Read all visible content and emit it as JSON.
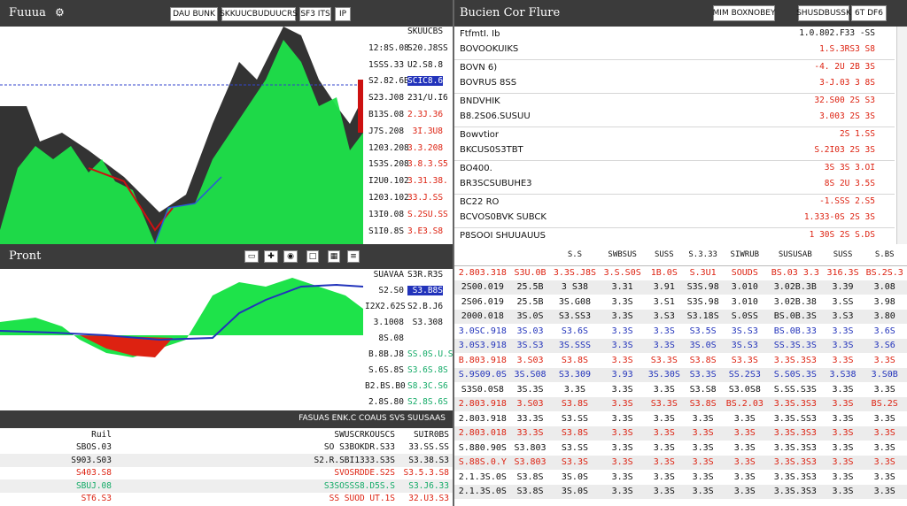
{
  "left_panel": {
    "title": "Fuuua",
    "tabs": [
      "DAU BUNK",
      "SKKUUCBUDUUCRS",
      "SF3 ITS",
      "IP"
    ],
    "price_labels": [
      {
        "left": "",
        "right": "SKUUCBS"
      },
      {
        "left": "12:8S.08",
        "right": "S20.J8SS"
      },
      {
        "left": "1SSS.33",
        "right": "U2.S8.8",
        "style": "white"
      },
      {
        "left": "S2.82.6B",
        "right": "SCIC8.6S",
        "style": "blue"
      },
      {
        "left": "S23.J08",
        "right": "231/U.I6"
      },
      {
        "left": "B13S.08",
        "right": "2.3J.36",
        "style": "red"
      },
      {
        "left": "J7S.208",
        "right": "3I.3U8",
        "style": "red"
      },
      {
        "left": "1203.208",
        "right": "3.3.208",
        "style": "red"
      },
      {
        "left": "1S3S.208",
        "right": "3.8.3.S5",
        "style": "red"
      },
      {
        "left": "I2U0.102",
        "right": "3.31.38.",
        "style": "red"
      },
      {
        "left": "1203.102",
        "right": "33.J.SS",
        "style": "red"
      },
      {
        "left": "13I0.08",
        "right": "S.2SU.SS",
        "style": "red"
      },
      {
        "left": "S1I0.8S",
        "right": "3.E3.S8",
        "style": "red"
      }
    ]
  },
  "mid_panel": {
    "title": "Pront",
    "price_labels": [
      {
        "left": "SUAVAA",
        "right": "S3R.R3S"
      },
      {
        "left": "S2.S0",
        "right": "S3.B8S",
        "style": "blue"
      },
      {
        "left": "I2X2.62S",
        "right": "S2.B.J6"
      },
      {
        "left": "3.1008",
        "right": "S3.308"
      },
      {
        "left": "8S.08",
        "right": "",
        "style": "red"
      },
      {
        "left": "B.8B.J8",
        "right": "SS.0S.U.S",
        "style": "green"
      },
      {
        "left": "S.6S.8S",
        "right": "S3.6S.8S",
        "style": "green"
      },
      {
        "left": "B2.BS.B0",
        "right": "S8.3C.S6",
        "style": "green"
      },
      {
        "left": "2.8S.80",
        "right": "S2.8S.6S",
        "style": "green"
      }
    ]
  },
  "bottom_panel": {
    "title": "FASUAS ENK.C COAUS SVS SUUSAAS",
    "header": [
      "Ruil",
      "SWUSCRKOUSCS",
      "SUIR0BS"
    ],
    "rows": [
      {
        "a": "SBOS.03",
        "b": "SO S3BOKDR.S33",
        "c": "33.SS.SS",
        "color": "black"
      },
      {
        "a": "S903.S03",
        "b": "S2.R.SBI1333.S3S",
        "c": "S3.38.S3",
        "color": "black"
      },
      {
        "a": "S403.S8",
        "b": "SVOSRDDE.S2S",
        "c": "S3.5.3.S8",
        "color": "red"
      },
      {
        "a": "SBUJ.08",
        "b": "S3SOSSS8.D5S.S",
        "c": "S3.J6.33",
        "color": "green"
      },
      {
        "a": "ST6.S3",
        "b": "SS SUOD UT.1S",
        "c": "32.U3.S3",
        "color": "red"
      }
    ]
  },
  "right_panel": {
    "title": "Bucien Cor Flure",
    "tabs": [
      "MIM BOXNOBEY",
      "SHUSDBUSSK",
      "6T DF6"
    ],
    "order_book": [
      {
        "l1": "FtfmtI. Ib",
        "l2": "BOVOOKUIKS",
        "r1": "1.0.802.F33 -SS",
        "r2": "1.S.3RS3 S8",
        "c1": "black",
        "c2": "red"
      },
      {
        "l1": "BOVN 6)",
        "l2": "BOVRUS 8SS",
        "r1": "-4. 2U  2B 3S",
        "r2": "3-J.03  3 8S",
        "c1": "red",
        "c2": "red"
      },
      {
        "l1": "BNDVHIK",
        "l2": "B8.2S06.SUSUU",
        "r1": "32.S00  2S  S3",
        "r2": "3.003  2S  3S",
        "c1": "red",
        "c2": "red"
      },
      {
        "l1": "Bowvtior",
        "l2": "BKCUS0S3TBT",
        "r1": "2S  1.SS",
        "r2": "S.2I03  2S  3S",
        "c1": "red",
        "c2": "red"
      },
      {
        "l1": "BO400.",
        "l2": "BR3SCSUBUHE3",
        "r1": "3S  3S  3.OI",
        "r2": "8S  2U  3.5S",
        "c1": "red",
        "c2": "red"
      },
      {
        "l1": "BC22 RO",
        "l2": "BCVOS0BVK SUBCK",
        "r1": "-1.SSS  2.S5",
        "r2": "1.333-0S  2S  3S",
        "c1": "red",
        "c2": "red"
      },
      {
        "l1": "P8SOOI SHUUAUUS",
        "l2": "",
        "r1": "1 30S  2S  S.DS",
        "r2": "",
        "c1": "red",
        "c2": "red"
      }
    ]
  },
  "grid": {
    "headers": [
      "S.S",
      "SWBSUS",
      "SUSS",
      "S.3.33",
      "SIWRUB",
      "SUSUSAB",
      "SUSS",
      "S.BS"
    ],
    "rows": [
      {
        "cells": [
          "2.803.318",
          "S3U.0B",
          "3.3S.J8S",
          "3.S.S0S",
          "1B.0S",
          "S.3U1",
          "SOUDS",
          "BS.03 3.3",
          "316.3S",
          "BS.2S.3"
        ],
        "color": "red"
      },
      {
        "cells": [
          "2S00.019",
          "25.5B",
          "3 S38",
          "3.31",
          "3.91",
          "S3S.98",
          "3.010",
          "3.02B.3B",
          "3.39",
          "3.08"
        ],
        "color": "black"
      },
      {
        "cells": [
          "2S06.019",
          "25.5B",
          "3S.G08",
          "3.3S",
          "3.S1",
          "S3S.98",
          "3.010",
          "3.02B.38",
          "3.SS",
          "3.98"
        ],
        "color": "black"
      },
      {
        "cells": [
          "2000.018",
          "3S.0S",
          "S3.SS3",
          "3.3S",
          "3.S3",
          "S3.18S",
          "S.0SS",
          "BS.0B.3S",
          "3.S3",
          "3.80"
        ],
        "color": "black"
      },
      {
        "cells": [
          "3.0SC.918",
          "3S.03",
          "S3.6S",
          "3.3S",
          "3.3S",
          "S3.5S",
          "3S.S3",
          "BS.0B.33",
          "3.3S",
          "3.6S"
        ],
        "color": "blue"
      },
      {
        "cells": [
          "3.0S3.918",
          "3S.S3",
          "3S.SSS",
          "3.3S",
          "3.3S",
          "3S.0S",
          "3S.S3",
          "SS.3S.3S",
          "3.3S",
          "3.S6"
        ],
        "color": "blue"
      },
      {
        "cells": [
          "B.803.918",
          "3.S03",
          "S3.8S",
          "3.3S",
          "S3.3S",
          "S3.8S",
          "S3.3S",
          "3.3S.3S3",
          "3.3S",
          "3.3S"
        ],
        "color": "red"
      },
      {
        "cells": [
          "S.9S09.0S",
          "3S.S08",
          "S3.309",
          "3.93",
          "3S.30S",
          "S3.3S",
          "SS.2S3",
          "S.S0S.3S",
          "3.S38",
          "3.S0B"
        ],
        "color": "blue"
      },
      {
        "cells": [
          "S3S0.0S8",
          "3S.3S",
          "3.3S",
          "3.3S",
          "3.3S",
          "S3.S8",
          "S3.0S8",
          "S.SS.S3S",
          "3.3S",
          "3.3S"
        ],
        "color": "black"
      },
      {
        "cells": [
          "2.803.918",
          "3.S03",
          "S3.8S",
          "3.3S",
          "S3.3S",
          "S3.8S",
          "BS.2.03",
          "3.3S.3S3",
          "3.3S",
          "BS.2S"
        ],
        "color": "red"
      },
      {
        "cells": [
          "2.803.918",
          "33.3S",
          "S3.SS",
          "3.3S",
          "3.3S",
          "3.3S",
          "3.3S",
          "3.3S.SS3",
          "3.3S",
          "3.3S"
        ],
        "color": "black"
      },
      {
        "cells": [
          "2.803.018",
          "33.3S",
          "S3.8S",
          "3.3S",
          "3.3S",
          "3.3S",
          "3.3S",
          "3.3S.3S3",
          "3.3S",
          "3.3S"
        ],
        "color": "red"
      },
      {
        "cells": [
          "S.880.90S",
          "S3.803",
          "S3.SS",
          "3.3S",
          "3.3S",
          "3.3S",
          "3.3S",
          "3.3S.3S3",
          "3.3S",
          "3.3S"
        ],
        "color": "black"
      },
      {
        "cells": [
          "S.88S.0.Y",
          "S3.803",
          "S3.3S",
          "3.3S",
          "3.3S",
          "3.3S",
          "3.3S",
          "3.3S.3S3",
          "3.3S",
          "3.3S"
        ],
        "color": "red"
      },
      {
        "cells": [
          "2.1.3S.0S",
          "S3.8S",
          "3S.0S",
          "3.3S",
          "3.3S",
          "3.3S",
          "3.3S",
          "3.3S.3S3",
          "3.3S",
          "3.3S"
        ],
        "color": "black"
      },
      {
        "cells": [
          "2.1.3S.0S",
          "S3.8S",
          "3S.0S",
          "3.3S",
          "3.3S",
          "3.3S",
          "3.3S",
          "3.3S.3S3",
          "3.3S",
          "3.3S"
        ],
        "color": "black"
      }
    ]
  },
  "colors": {
    "up": "#1ee34a",
    "down": "#d21",
    "accent": "#23b",
    "bar": "#3b3b3b"
  }
}
